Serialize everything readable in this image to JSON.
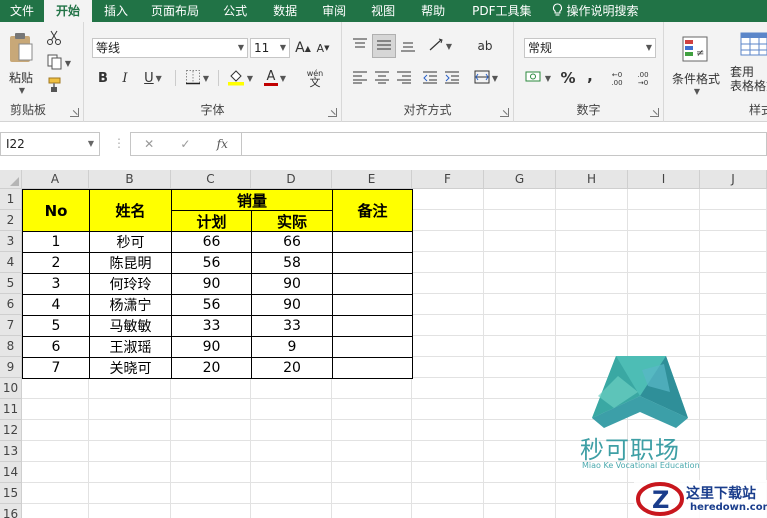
{
  "ribbon_tabs": [
    "文件",
    "开始",
    "插入",
    "页面布局",
    "公式",
    "数据",
    "审阅",
    "视图",
    "帮助",
    "PDF工具集",
    "操作说明搜索"
  ],
  "active_tab": "开始",
  "clipboard": {
    "paste_label": "粘贴",
    "group_label": "剪贴板"
  },
  "font": {
    "family": "等线",
    "size": "11",
    "group_label": "字体",
    "bold": "B",
    "italic": "I",
    "underline": "U",
    "grow": "A",
    "shrink": "A",
    "font_color": "A",
    "phonetic": "wén"
  },
  "alignment": {
    "group_label": "对齐方式",
    "wrap": "ab"
  },
  "number": {
    "format": "常规",
    "group_label": "数字",
    "percent": "%",
    "comma": ",",
    "inc_dec": "←0 .00",
    "dec_dec": ".00 →0"
  },
  "styles": {
    "conditional": "条件格式",
    "table_format": "套用\n表格格式",
    "group_label_partial": "样式"
  },
  "formula_bar": {
    "name_box": "I22",
    "fx": "fx",
    "cancel": "✕",
    "confirm": "✓",
    "value": ""
  },
  "columns": [
    "A",
    "B",
    "C",
    "D",
    "E",
    "F",
    "G",
    "H",
    "I",
    "J"
  ],
  "rows": [
    "1",
    "2",
    "3",
    "4",
    "5",
    "6",
    "7",
    "8",
    "9",
    "10",
    "11",
    "12",
    "13",
    "14",
    "15",
    "16"
  ],
  "table": {
    "header_no": "No",
    "header_name": "姓名",
    "header_sales": "销量",
    "header_plan": "计划",
    "header_actual": "实际",
    "header_note": "备注",
    "records": [
      {
        "no": "1",
        "name": "秒可",
        "plan": "66",
        "actual": "66"
      },
      {
        "no": "2",
        "name": "陈昆明",
        "plan": "56",
        "actual": "58"
      },
      {
        "no": "3",
        "name": "何玲玲",
        "plan": "90",
        "actual": "90"
      },
      {
        "no": "4",
        "name": "杨潇宁",
        "plan": "56",
        "actual": "90"
      },
      {
        "no": "5",
        "name": "马敏敏",
        "plan": "33",
        "actual": "33"
      },
      {
        "no": "6",
        "name": "王淑瑶",
        "plan": "90",
        "actual": "9"
      },
      {
        "no": "7",
        "name": "关晓可",
        "plan": "20",
        "actual": "20"
      }
    ]
  },
  "watermark": {
    "brand": "秒可职场",
    "subtitle": "Miao Ke Vocational Education",
    "site_name": "这里下载站",
    "site_url": "heredown.com"
  },
  "colors": {
    "excel_green": "#217346",
    "header_yellow": "#ffff00",
    "logo_teal": "#3e9fa5"
  }
}
